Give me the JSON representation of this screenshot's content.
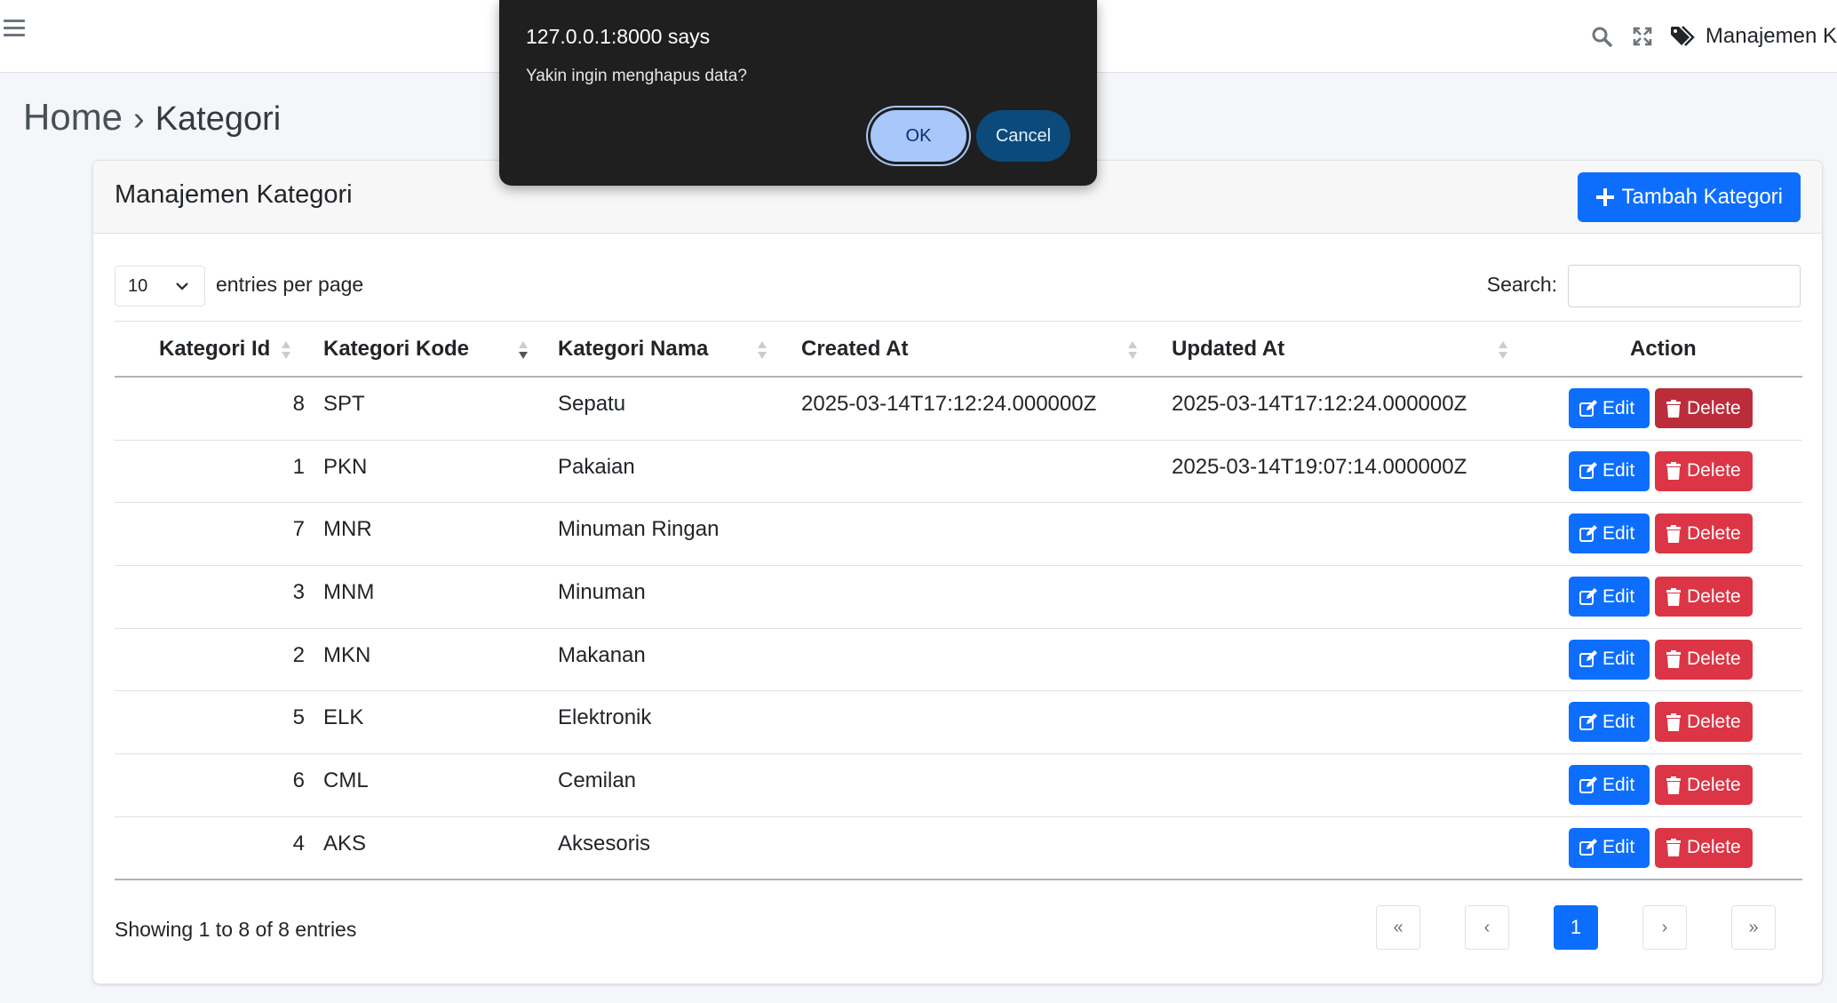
{
  "navbar": {
    "user_label": "Manajemen K"
  },
  "breadcrumb": {
    "home": "Home",
    "separator": "›",
    "current": "Kategori"
  },
  "card": {
    "title": "Manajemen Kategori",
    "add_button": "Tambah Kategori"
  },
  "controls": {
    "entries_value": "10",
    "entries_label": "entries per page",
    "search_label": "Search:",
    "search_value": ""
  },
  "table": {
    "headers": [
      "Kategori Id",
      "Kategori Kode",
      "Kategori Nama",
      "Created At",
      "Updated At",
      "Action"
    ],
    "rows": [
      {
        "id": "8",
        "kode": "SPT",
        "nama": "Sepatu",
        "created": "2025-03-14T17:12:24.000000Z",
        "updated": "2025-03-14T17:12:24.000000Z"
      },
      {
        "id": "1",
        "kode": "PKN",
        "nama": "Pakaian",
        "created": "",
        "updated": "2025-03-14T19:07:14.000000Z"
      },
      {
        "id": "7",
        "kode": "MNR",
        "nama": "Minuman Ringan",
        "created": "",
        "updated": ""
      },
      {
        "id": "3",
        "kode": "MNM",
        "nama": "Minuman",
        "created": "",
        "updated": ""
      },
      {
        "id": "2",
        "kode": "MKN",
        "nama": "Makanan",
        "created": "",
        "updated": ""
      },
      {
        "id": "5",
        "kode": "ELK",
        "nama": "Elektronik",
        "created": "",
        "updated": ""
      },
      {
        "id": "6",
        "kode": "CML",
        "nama": "Cemilan",
        "created": "",
        "updated": ""
      },
      {
        "id": "4",
        "kode": "AKS",
        "nama": "Aksesoris",
        "created": "",
        "updated": ""
      }
    ],
    "edit_label": "Edit",
    "delete_label": "Delete"
  },
  "footer": {
    "info": "Showing 1 to 8 of 8 entries",
    "pages": [
      "«",
      "‹",
      "1",
      "›",
      "»"
    ]
  },
  "dialog": {
    "title": "127.0.0.1:8000 says",
    "message": "Yakin ingin menghapus data?",
    "ok": "OK",
    "cancel": "Cancel"
  },
  "colors": {
    "primary": "#0d6efd",
    "danger": "#dc3545",
    "dialog_bg": "#1f1f1f"
  }
}
